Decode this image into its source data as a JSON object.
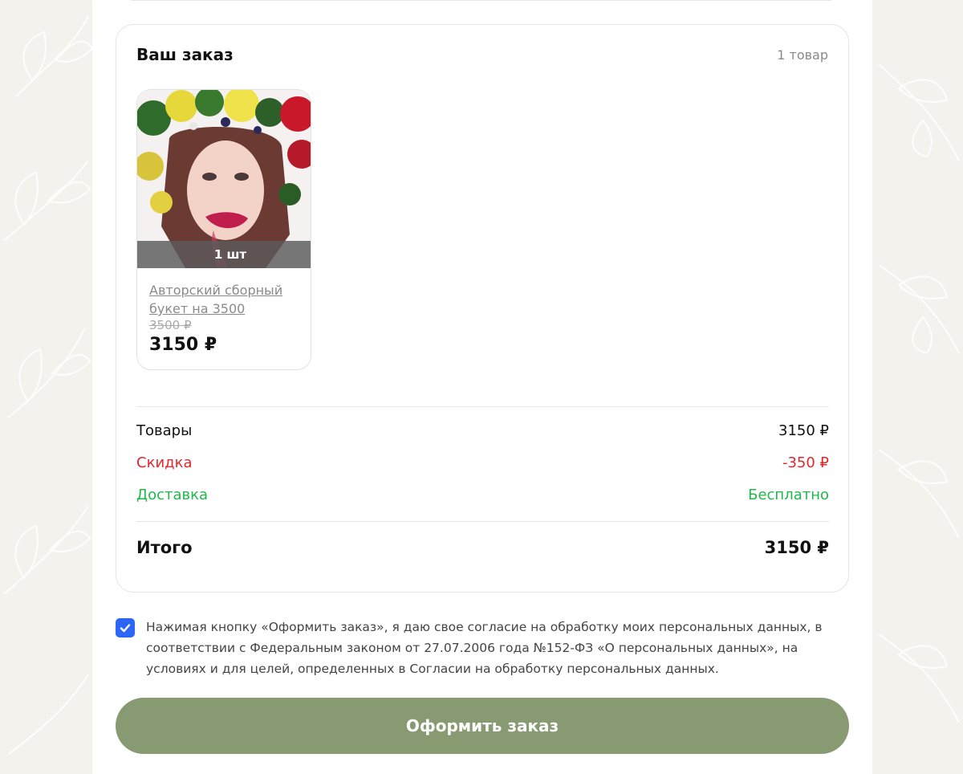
{
  "order": {
    "title": "Ваш заказ",
    "count": "1 товар"
  },
  "product": {
    "quantity": "1 шт",
    "name": "Авторский сборный букет на 3500",
    "old_price": "3500 ₽",
    "price": "3150 ₽"
  },
  "summary": {
    "goods_label": "Товары",
    "goods_value": "3150 ₽",
    "discount_label": "Скидка",
    "discount_value": "-350 ₽",
    "delivery_label": "Доставка",
    "delivery_value": "Бесплатно",
    "total_label": "Итого",
    "total_value": "3150 ₽"
  },
  "consent": {
    "checked": true,
    "text": "Нажимая кнопку «Оформить заказ», я даю свое согласие на обработку моих персональных данных, в соответствии с Федеральным законом от 27.07.2006 года №152-ФЗ «О персональных данных», на условиях и для целей, определенных в Согласии на обработку персональных данных."
  },
  "submit_label": "Оформить заказ",
  "colors": {
    "accent_button": "#889a72",
    "discount": "#e3262b",
    "delivery": "#1fb94b",
    "checkbox": "#2b66f6"
  }
}
